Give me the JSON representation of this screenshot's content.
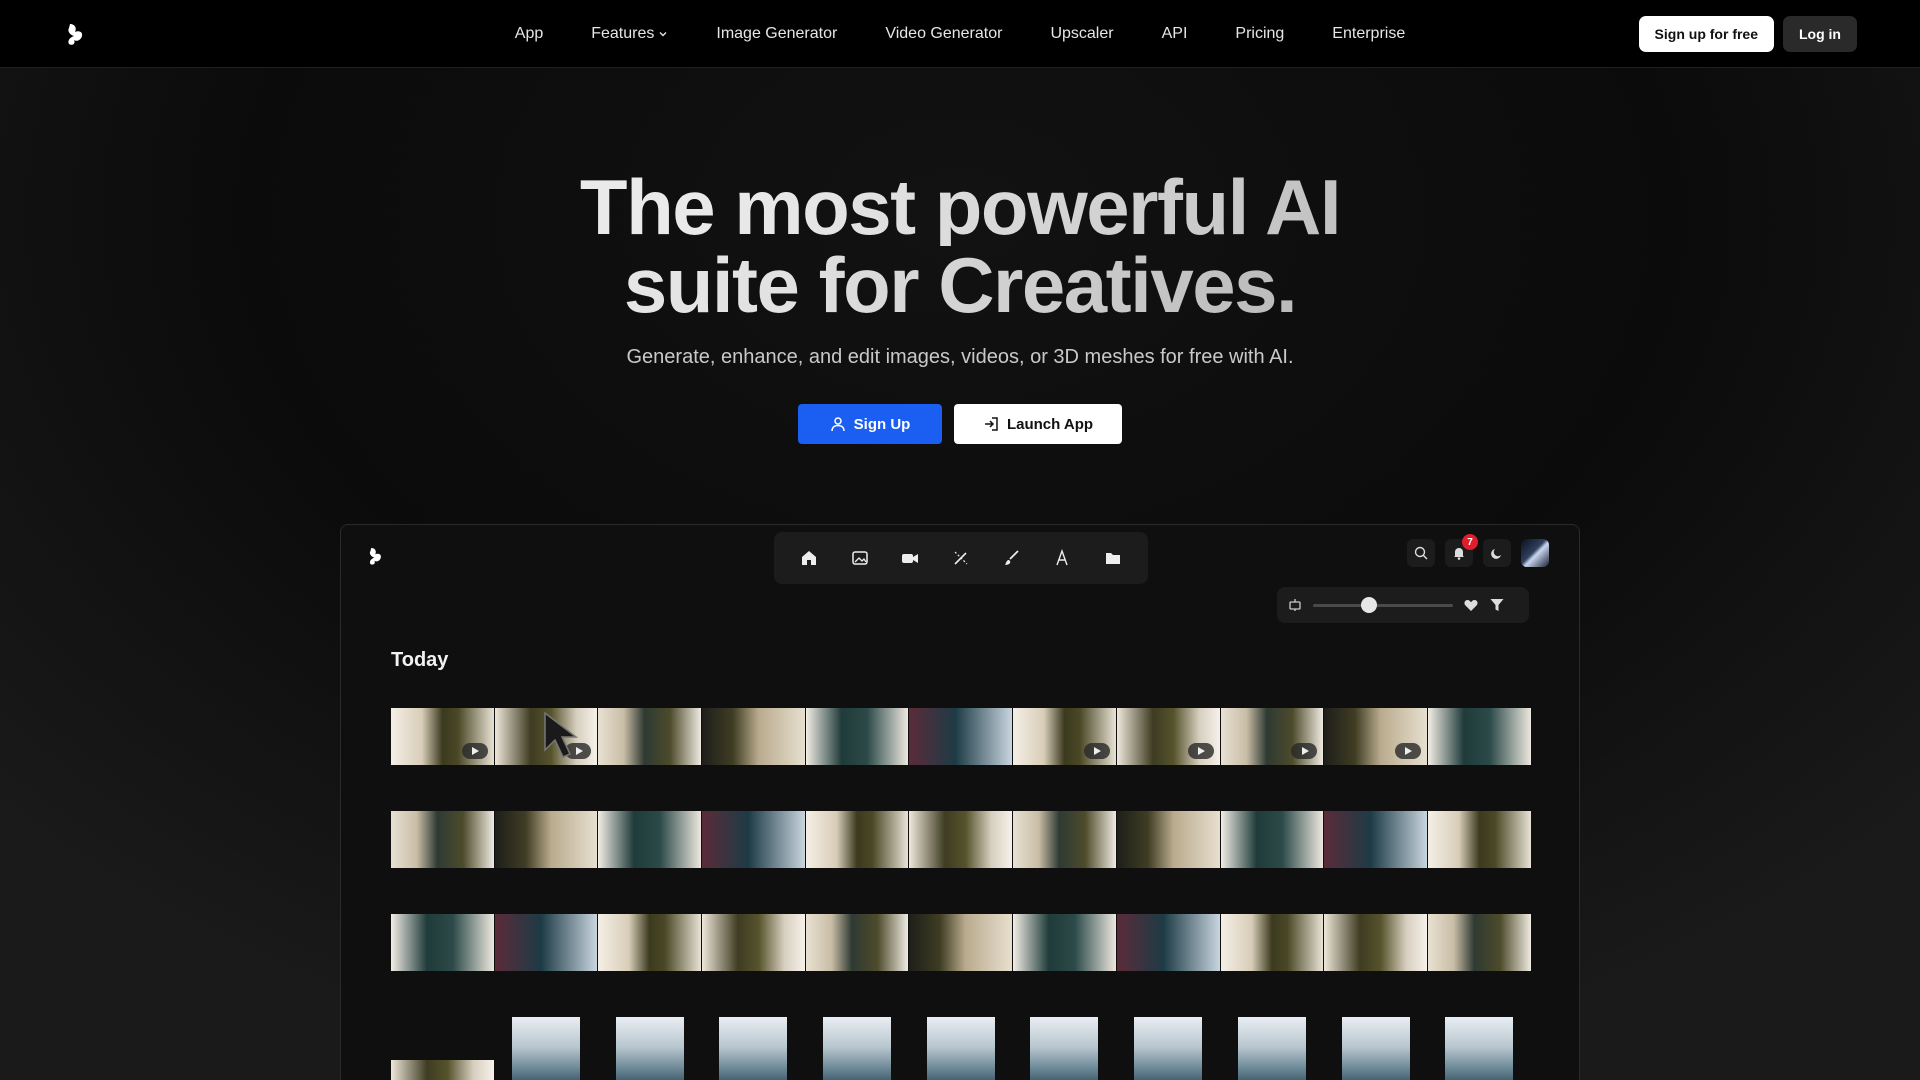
{
  "nav": {
    "links": [
      "App",
      "Features",
      "Image Generator",
      "Video Generator",
      "Upscaler",
      "API",
      "Pricing",
      "Enterprise"
    ],
    "signup_free": "Sign up for free",
    "login": "Log in"
  },
  "hero": {
    "title_line1_a": "The most powerful AI",
    "title_line2_a": "suite for Creatives.",
    "subtitle": "Generate, enhance, and edit images, videos, or 3D meshes for free with AI.",
    "signup_btn": "Sign Up",
    "launch_btn": "Launch App"
  },
  "app": {
    "toolbar_icons": [
      "home-icon",
      "image-icon",
      "video-camera-icon",
      "magic-wand-icon",
      "brush-icon",
      "font-icon",
      "folder-icon"
    ],
    "notifications_count": "7",
    "zoom_value": 0.4,
    "section_title": "Today",
    "rows": [
      {
        "count": 11,
        "video_positions": [
          0,
          1,
          6,
          7,
          8,
          9
        ]
      },
      {
        "count": 11,
        "video_positions": []
      },
      {
        "count": 11,
        "video_positions": []
      },
      {
        "count": 11,
        "portrait_from": 1
      }
    ]
  },
  "colors": {
    "primary": "#1a5ff2",
    "background": "#000000",
    "badge": "#e11d2b"
  }
}
